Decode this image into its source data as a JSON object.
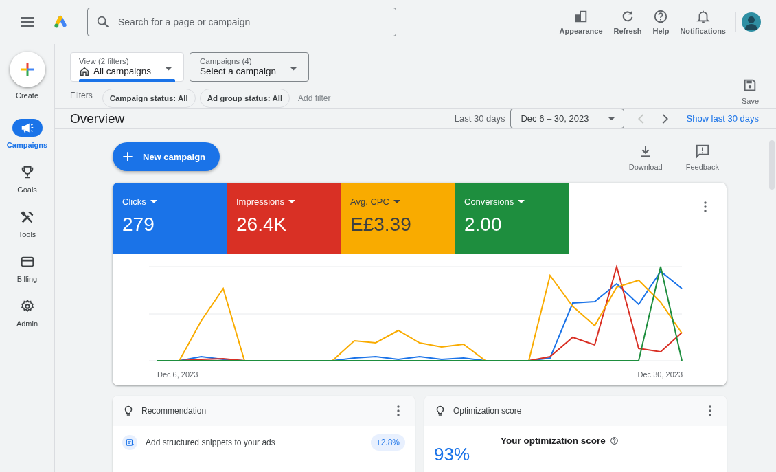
{
  "top_bar": {
    "search": {
      "placeholder": "Search for a page or campaign"
    },
    "actions": [
      {
        "label": "Appearance"
      },
      {
        "label": "Refresh"
      },
      {
        "label": "Help"
      },
      {
        "label": "Notifications"
      }
    ]
  },
  "side_nav": {
    "create": {
      "label": "Create"
    },
    "items": [
      {
        "label": "Campaigns",
        "selected": true
      },
      {
        "label": "Goals",
        "selected": false
      },
      {
        "label": "Tools",
        "selected": false
      },
      {
        "label": "Billing",
        "selected": false
      },
      {
        "label": "Admin",
        "selected": false
      }
    ]
  },
  "selectors": [
    {
      "label": "View (2 filters)",
      "value": "All campaigns",
      "focused": true
    },
    {
      "label": "Campaigns (4)",
      "value": "Select a campaign",
      "focused": false
    }
  ],
  "filters": {
    "label": "Filters",
    "chips": [
      "Campaign status: All",
      "Ad group status: All"
    ],
    "add": "Add filter"
  },
  "save": {
    "label": "Save"
  },
  "overview": {
    "title": "Overview",
    "range_label": "Last 30 days",
    "date_range": "Dec 6 – 30, 2023",
    "previous": {
      "disabled": true
    },
    "next": {
      "disabled": false
    },
    "link": "Show last 30 days"
  },
  "new_campaign": {
    "label": "New campaign"
  },
  "tools": [
    {
      "label": "Download"
    },
    {
      "label": "Feedback"
    }
  ],
  "metrics": [
    {
      "label": "Clicks",
      "value": "279",
      "color": "#1a73e8"
    },
    {
      "label": "Impressions",
      "value": "26.4K",
      "color": "#d93025"
    },
    {
      "label": "Avg. CPC",
      "value": "E£3.39",
      "color": "#f9ab00"
    },
    {
      "label": "Conversions",
      "value": "2.00",
      "color": "#1e8e3e"
    }
  ],
  "chart": {
    "x_start": "Dec 6, 2023",
    "x_end": "Dec 30, 2023"
  },
  "cards": [
    {
      "kind": "recommendation",
      "title": "Recommendation",
      "item": {
        "text": "Add structured snippets to your ads",
        "badge": "+2.8%"
      }
    },
    {
      "kind": "score",
      "title": "Optimization score",
      "score": "93%",
      "heading": "Your optimization score"
    }
  ]
}
